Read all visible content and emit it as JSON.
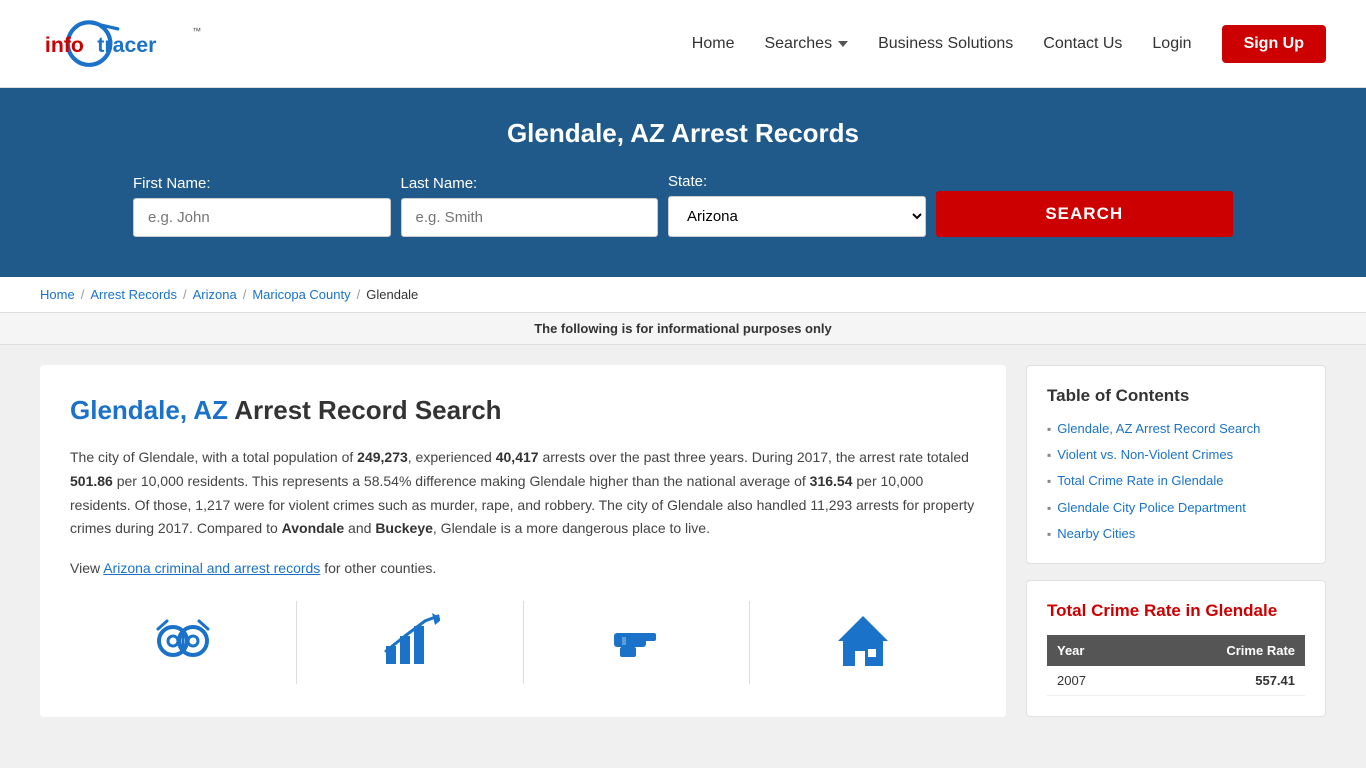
{
  "header": {
    "logo_text": "infotracer",
    "nav_items": [
      {
        "label": "Home",
        "id": "home"
      },
      {
        "label": "Searches",
        "id": "searches",
        "has_dropdown": true
      },
      {
        "label": "Business Solutions",
        "id": "business"
      },
      {
        "label": "Contact Us",
        "id": "contact"
      }
    ],
    "login_label": "Login",
    "signup_label": "Sign Up"
  },
  "hero": {
    "title": "Glendale, AZ Arrest Records",
    "first_name_label": "First Name:",
    "first_name_placeholder": "e.g. John",
    "last_name_label": "Last Name:",
    "last_name_placeholder": "e.g. Smith",
    "state_label": "State:",
    "state_value": "Arizona",
    "search_button": "SEARCH"
  },
  "breadcrumb": {
    "items": [
      {
        "label": "Home",
        "href": "#"
      },
      {
        "label": "Arrest Records",
        "href": "#"
      },
      {
        "label": "Arizona",
        "href": "#"
      },
      {
        "label": "Maricopa County",
        "href": "#"
      },
      {
        "label": "Glendale",
        "href": "#",
        "current": true
      }
    ]
  },
  "info_bar": {
    "text": "The following is for informational purposes only"
  },
  "article": {
    "title_highlight": "Glendale, AZ",
    "title_rest": " Arrest Record Search",
    "body_intro": "The city of Glendale, with a total population of ",
    "population": "249,273",
    "body_1": ", experienced ",
    "arrests": "40,417",
    "body_2": " arrests over the past three years. During 2017, the arrest rate totaled ",
    "rate": "501.86",
    "body_3": " per 10,000 residents. This represents a 58.54% difference making Glendale higher than the national average of ",
    "national_avg": "316.54",
    "body_4": " per 10,000 residents. Of those, 1,217 were for violent crimes such as murder, rape, and robbery. The city of Glendale also handled 11,293 arrests for property crimes during 2017. Compared to ",
    "city1": "Avondale",
    "body_5": " and ",
    "city2": "Buckeye",
    "body_6": ", Glendale is a more dangerous place to live.",
    "view_text": "View ",
    "az_link_text": "Arizona criminal and arrest records",
    "view_text2": " for other counties."
  },
  "toc": {
    "title": "Table of Contents",
    "items": [
      {
        "label": "Glendale, AZ Arrest Record Search",
        "href": "#"
      },
      {
        "label": "Violent vs. Non-Violent Crimes",
        "href": "#"
      },
      {
        "label": "Total Crime Rate in Glendale",
        "href": "#"
      },
      {
        "label": "Glendale City Police Department",
        "href": "#"
      },
      {
        "label": "Nearby Cities",
        "href": "#"
      }
    ]
  },
  "crime_rate": {
    "title": "Total Crime Rate in Glendale",
    "col_year": "Year",
    "col_rate": "Crime Rate",
    "rows": [
      {
        "year": "2007",
        "rate": "557.41"
      }
    ]
  },
  "icons": [
    {
      "id": "handcuffs",
      "title": "Arrest"
    },
    {
      "id": "chart",
      "title": "Crime Stats"
    },
    {
      "id": "gun",
      "title": "Violent Crime"
    },
    {
      "id": "house",
      "title": "Property Crime"
    }
  ]
}
